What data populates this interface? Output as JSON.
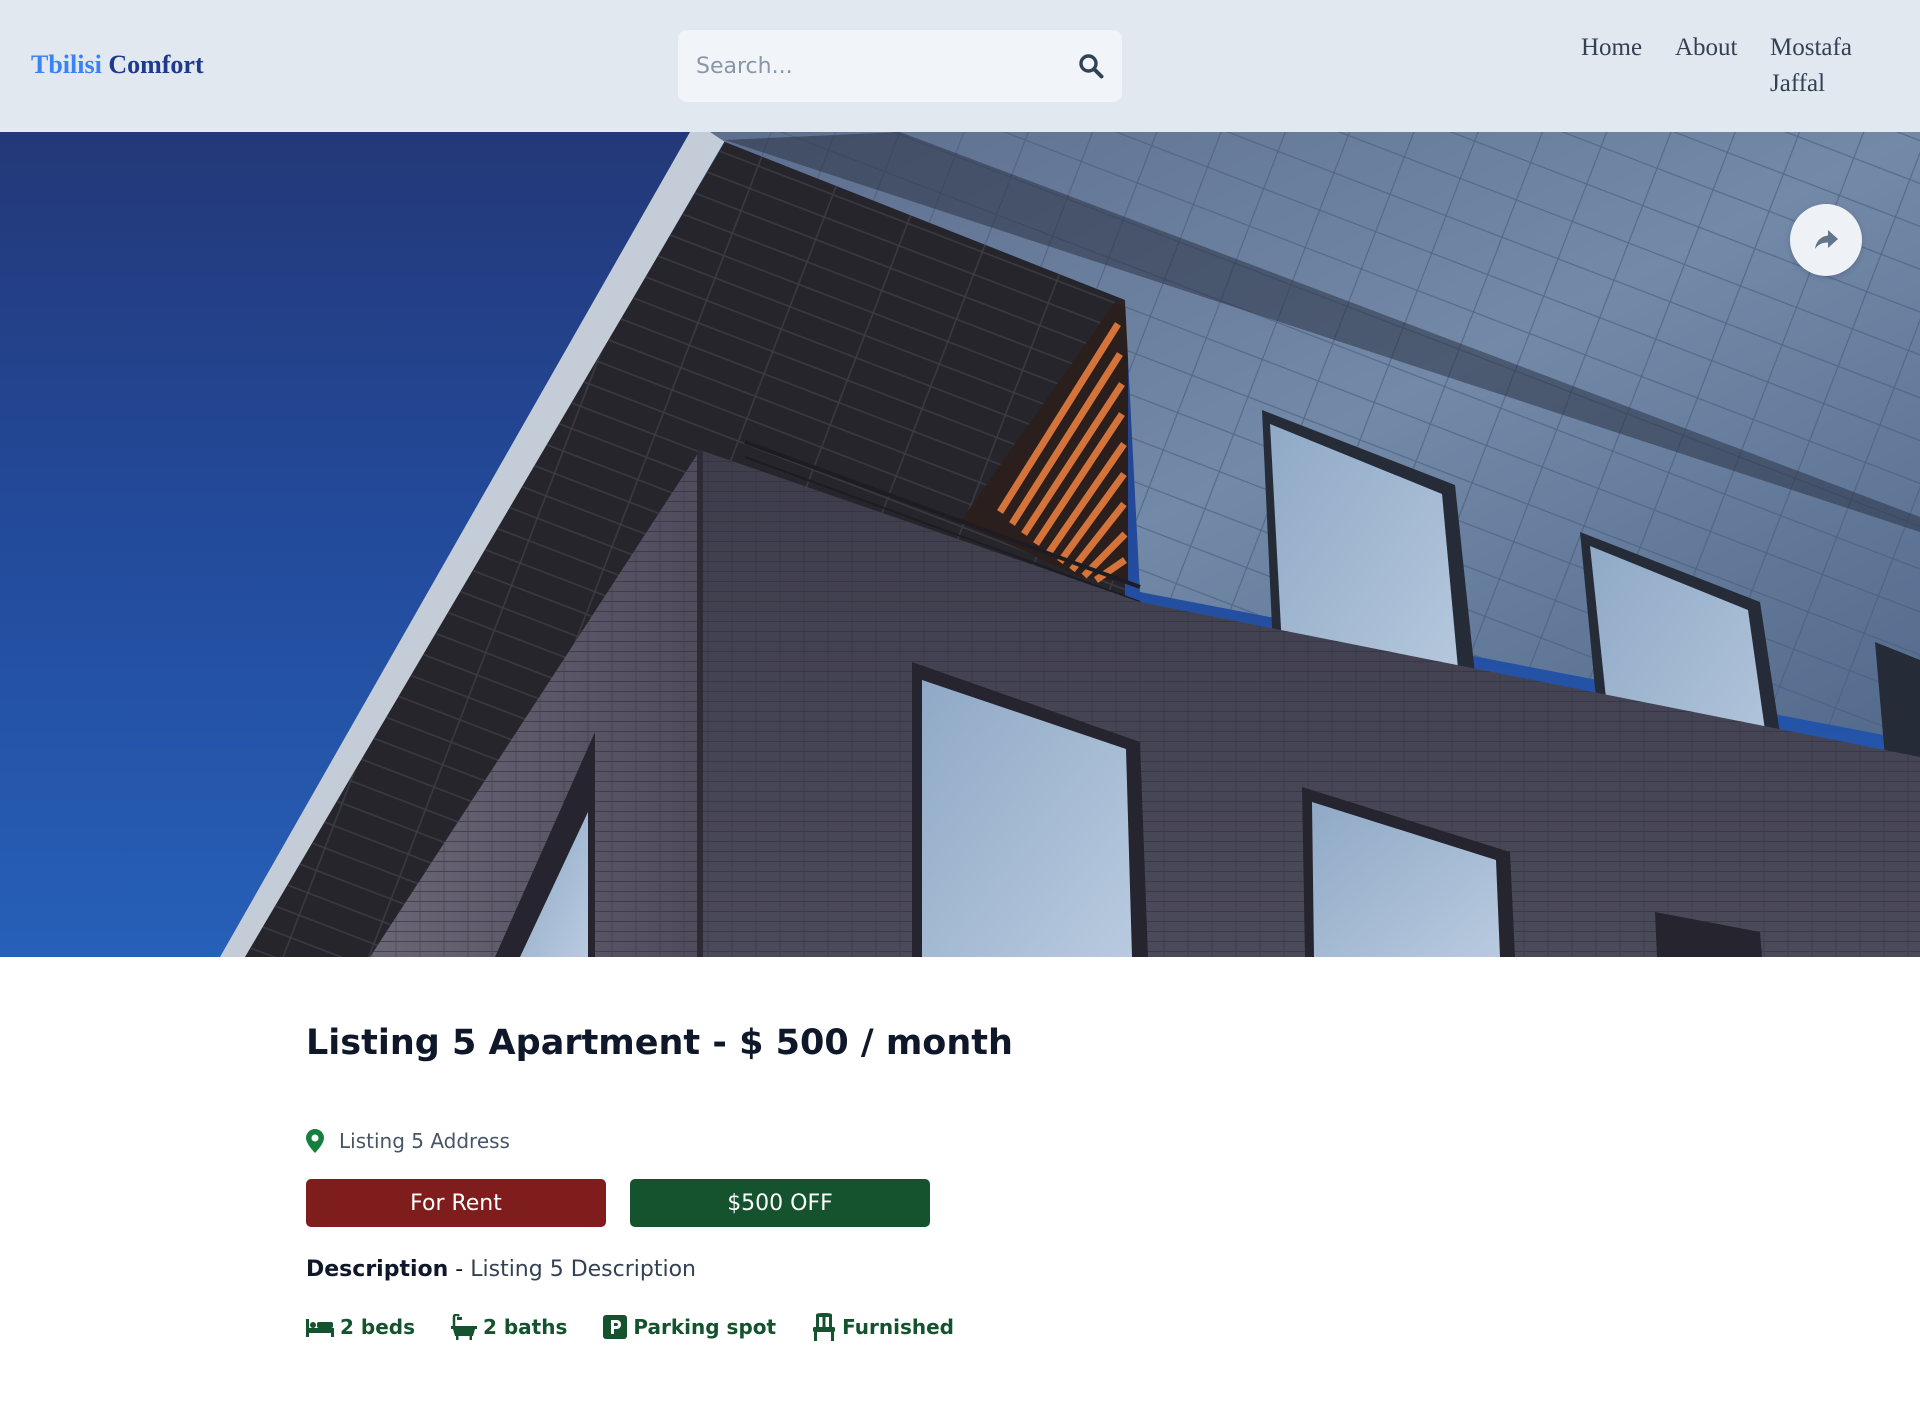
{
  "brand": {
    "name_first": "Tbilisi",
    "name_second": "Comfort"
  },
  "search": {
    "placeholder": "Search..."
  },
  "nav": {
    "home": "Home",
    "about": "About",
    "user": "Mostafa Jaffal"
  },
  "hero": {
    "image": "modern-apartment-building-photo",
    "share_icon": "share-icon"
  },
  "listing": {
    "name": "Listing 5 Apartment",
    "separator": " - ",
    "price": "$ 500 / month",
    "address": "Listing 5 Address",
    "type_badge": "For Rent",
    "offer_badge": "$500 OFF",
    "description_label": "Description",
    "description_separator": " - ",
    "description": "Listing 5 Description",
    "features": {
      "beds": "2 beds",
      "baths": "2 baths",
      "parking": "Parking spot",
      "furnished": "Furnished"
    }
  },
  "colors": {
    "header_bg": "#e2e8f0",
    "brand_light": "#3b82f6",
    "brand_dark": "#1e3a8a",
    "rent_badge": "#7f1d1d",
    "offer_badge": "#14532d",
    "feature_text": "#14532d",
    "pin": "#15803d"
  }
}
